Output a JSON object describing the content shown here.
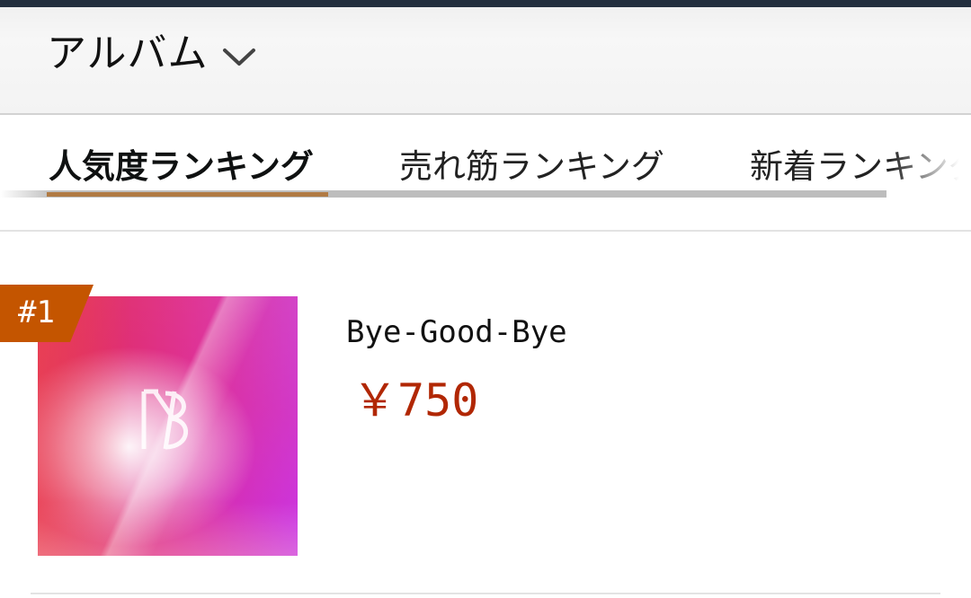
{
  "header": {
    "category_label": "アルバム",
    "chevron_icon": "chevron-down-icon"
  },
  "tabs": [
    {
      "label": "人気度ランキング",
      "active": true
    },
    {
      "label": "売れ筋ランキング",
      "active": false
    },
    {
      "label": "新着ランキング",
      "active": false
    }
  ],
  "colors": {
    "top_strip": "#232f3e",
    "active_tab_indicator": "#b07a43",
    "rank_badge": "#c45500",
    "price": "#b12704"
  },
  "products": [
    {
      "rank": "#1",
      "title": "Bye-Good-Bye",
      "price": "￥750",
      "image_icon": "album-cover-image"
    }
  ]
}
